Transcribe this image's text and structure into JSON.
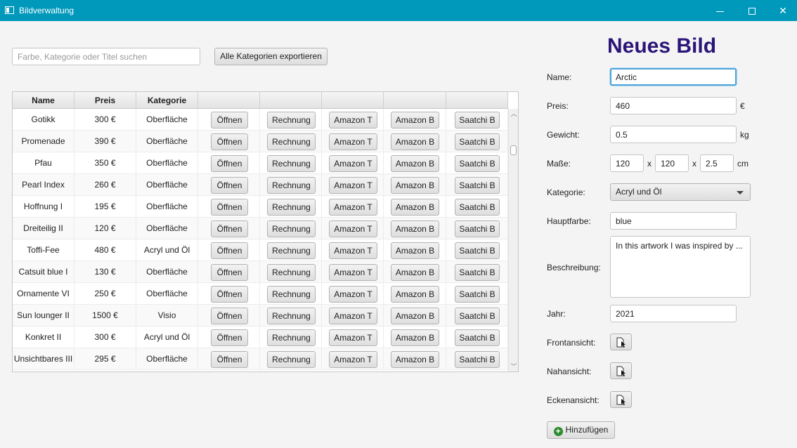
{
  "window": {
    "title": "Bildverwaltung"
  },
  "toolbar": {
    "search_placeholder": "Farbe, Kategorie oder Titel suchen",
    "export_label": "Alle Kategorien exportieren"
  },
  "table": {
    "headers": [
      "Name",
      "Preis",
      "Kategorie",
      "",
      "",
      "",
      "",
      ""
    ],
    "button_labels": [
      "Öffnen",
      "Rechnung",
      "Amazon T",
      "Amazon B",
      "Saatchi B"
    ],
    "rows": [
      {
        "name": "Gotikk",
        "price": "300 €",
        "category": "Oberfläche"
      },
      {
        "name": "Promenade",
        "price": "390 €",
        "category": "Oberfläche"
      },
      {
        "name": "Pfau",
        "price": "350 €",
        "category": "Oberfläche"
      },
      {
        "name": "Pearl Index",
        "price": "260 €",
        "category": "Oberfläche"
      },
      {
        "name": "Hoffnung I",
        "price": "195 €",
        "category": "Oberfläche"
      },
      {
        "name": "Dreiteilig II",
        "price": "120 €",
        "category": "Oberfläche"
      },
      {
        "name": "Toffi-Fee",
        "price": "480 €",
        "category": "Acryl und Öl"
      },
      {
        "name": "Catsuit blue I",
        "price": "130 €",
        "category": "Oberfläche"
      },
      {
        "name": "Ornamente VI",
        "price": "250 €",
        "category": "Oberfläche"
      },
      {
        "name": "Sun lounger II",
        "price": "1500 €",
        "category": "Visio"
      },
      {
        "name": "Konkret II",
        "price": "300 €",
        "category": "Acryl und Öl"
      },
      {
        "name": "Unsichtbares III",
        "price": "295 €",
        "category": "Oberfläche"
      }
    ]
  },
  "form": {
    "title": "Neues Bild",
    "name_label": "Name:",
    "name_value": "Arctic",
    "price_label": "Preis:",
    "price_value": "460",
    "price_unit": "€",
    "weight_label": "Gewicht:",
    "weight_value": "0.5",
    "weight_unit": "kg",
    "dims_label": "Maße:",
    "dim_w": "120",
    "dim_h": "120",
    "dim_d": "2.5",
    "dim_sep": "x",
    "dim_unit": "cm",
    "category_label": "Kategorie:",
    "category_value": "Acryl und Öl",
    "main_color_label": "Hauptfarbe:",
    "main_color_value": "blue",
    "description_label": "Beschreibung:",
    "description_value": "In this artwork I was inspired by ...",
    "year_label": "Jahr:",
    "year_value": "2021",
    "front_view_label": "Frontansicht:",
    "close_view_label": "Nahansicht:",
    "corner_view_label": "Eckenansicht:",
    "add_label": "Hinzufügen"
  },
  "colors": {
    "titlebar": "#0099bc",
    "form_title": "#2b1478",
    "add_icon": "#2e8b2e"
  }
}
